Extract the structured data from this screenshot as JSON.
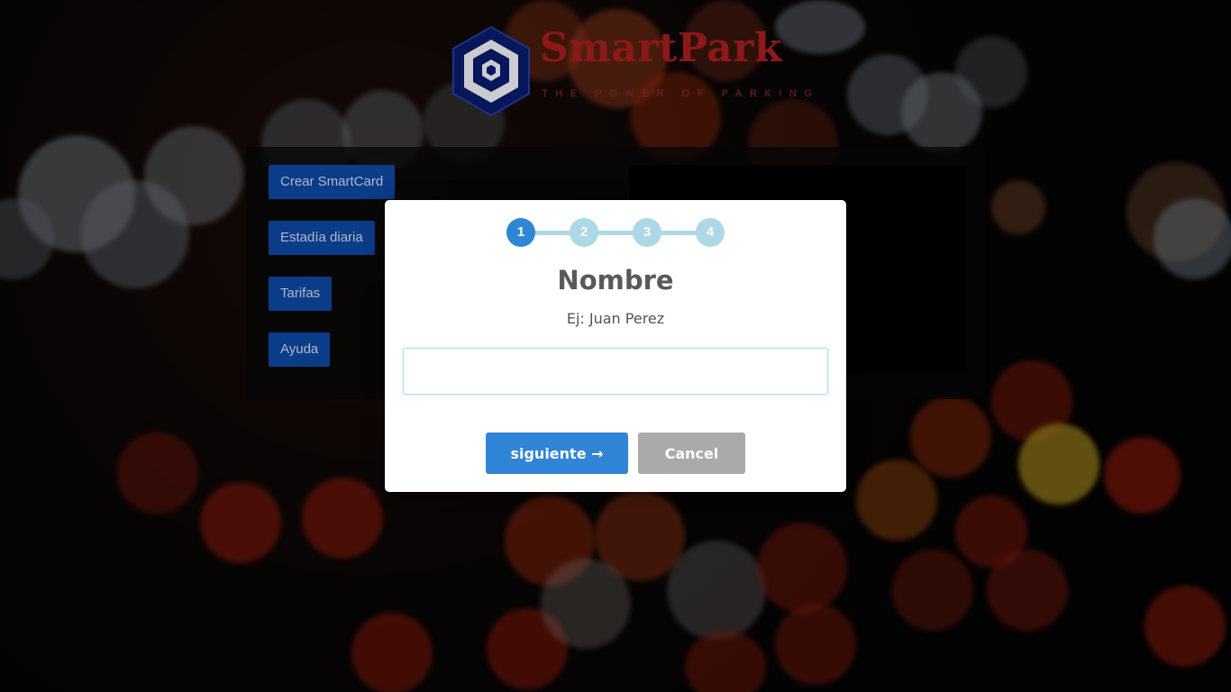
{
  "logo": {
    "name": "SmartPark",
    "tagline": "THE POWER OF PARKING"
  },
  "menu": {
    "buttons": [
      {
        "label": "Crear SmartCard"
      },
      {
        "label": "Estadía diaria"
      },
      {
        "label": "Tarifas"
      },
      {
        "label": "Ayuda"
      }
    ]
  },
  "modal": {
    "steps": [
      "1",
      "2",
      "3",
      "4"
    ],
    "active_step": 1,
    "title": "Nombre",
    "text": "Ej: Juan Perez",
    "input_value": "",
    "next_label": "siguiente →",
    "cancel_label": "Cancel"
  },
  "colors": {
    "accent": "#3085d6",
    "step_inactive": "#add8e6",
    "cancel": "#aaaaaa",
    "menu_button": "#0d47a1",
    "logo_red": "#a61d1d",
    "logo_blue": "#0a1a6b"
  }
}
